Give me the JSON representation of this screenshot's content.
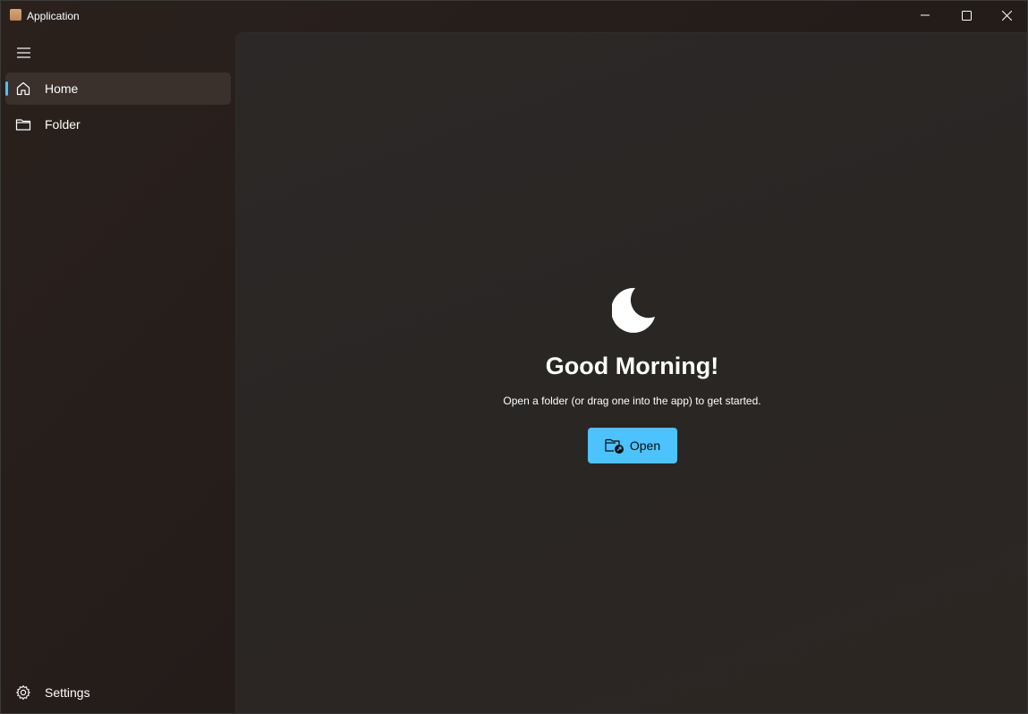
{
  "window": {
    "title": "Application",
    "accent_color": "#4cc2ff",
    "caption_buttons": [
      "minimize-icon",
      "maximize-icon",
      "close-icon"
    ]
  },
  "sidebar": {
    "menu_icon": "hamburger-icon",
    "items": [
      {
        "label": "Home",
        "icon": "home-icon",
        "selected": true
      },
      {
        "label": "Folder",
        "icon": "folder-icon",
        "selected": false
      }
    ],
    "footer": {
      "label": "Settings",
      "icon": "gear-icon"
    }
  },
  "main": {
    "icon": "moon-icon",
    "greeting": "Good Morning!",
    "subtitle": "Open a folder (or drag one into the app) to get started.",
    "open_button": {
      "label": "Open",
      "icon": "folder-open-icon"
    }
  }
}
